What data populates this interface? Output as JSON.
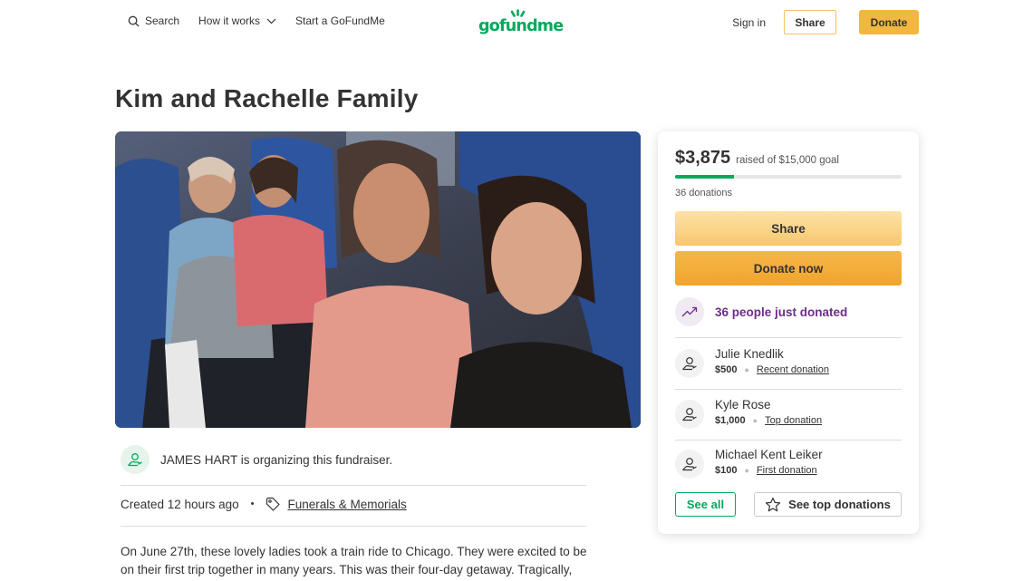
{
  "header": {
    "search_label": "Search",
    "how_it_works_label": "How it works",
    "start_label": "Start a GoFundMe",
    "logo_text": "gofundme",
    "sign_in_label": "Sign in",
    "share_label": "Share",
    "donate_label": "Donate"
  },
  "campaign": {
    "title": "Kim and Rachelle Family",
    "organizer_name": "JAMES HART",
    "organizer_suffix": " is organizing this fundraiser.",
    "created": "Created 12 hours ago",
    "category": "Funerals & Memorials",
    "story": "On June 27th, these lovely ladies took a train ride to Chicago. They were excited to be on their first trip together in many years. This was their four-day getaway. Tragically, the train"
  },
  "donation_card": {
    "raised": "$3,875",
    "goal_text": "raised of $15,000 goal",
    "progress_fraction": 0.258,
    "donations_count": "36 donations",
    "share_label": "Share",
    "donate_label": "Donate now",
    "trend_text": "36 people just donated",
    "donors": [
      {
        "name": "Julie Knedlik",
        "amount": "$500",
        "tag": "Recent donation"
      },
      {
        "name": "Kyle Rose",
        "amount": "$1,000",
        "tag": "Top donation"
      },
      {
        "name": "Michael Kent Leiker",
        "amount": "$100",
        "tag": "First donation"
      }
    ],
    "see_all_label": "See all",
    "see_top_label": "See top donations"
  },
  "colors": {
    "brand_green": "#02a95c",
    "donate_orange": "#f0a52c",
    "trend_purple": "#6f2c8a"
  },
  "icons": {
    "search": "search-icon",
    "chevron": "chevron-down-icon",
    "tag": "tag-icon",
    "trend": "trending-up-icon",
    "donor": "donor-hand-icon",
    "star": "star-icon"
  }
}
